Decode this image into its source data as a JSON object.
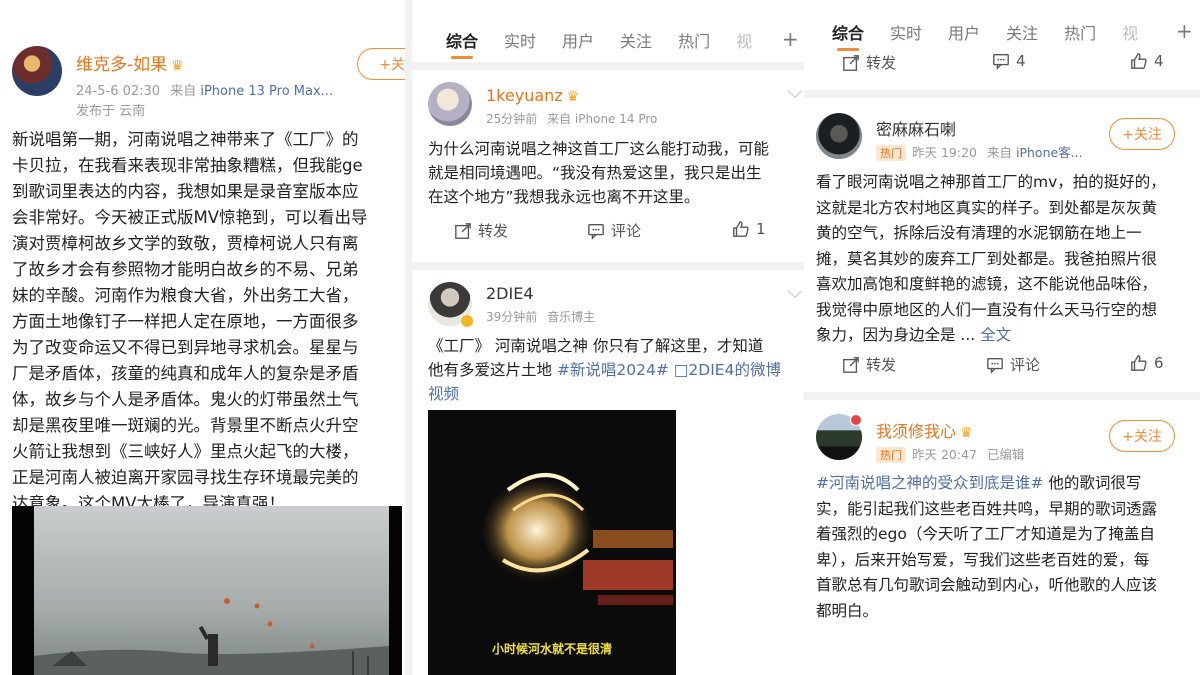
{
  "panel1": {
    "post": {
      "user": "维克多-如果",
      "time": "24-5-6 02:30",
      "source_prefix": "来自",
      "device": "iPhone 13 Pro Max...",
      "location": "发布于 云南",
      "follow": "+关",
      "lines": [
        "新说唱第一期，河南说唱之神带来了《工厂》的",
        "卡贝拉，在我看来表现非常抽象糟糕，但我能ge",
        "到歌词里表达的内容，我想如果是录音室版本应",
        "会非常好。今天被正式版MV惊艳到，可以看出导",
        "演对贾樟柯故乡文学的致敬，贾樟柯说人只有离",
        "了故乡才会有参照物才能明白故乡的不易、兄弟",
        "妹的辛酸。河南作为粮食大省，外出务工大省，",
        "方面土地像钉子一样把人定在原地，一方面很多",
        "为了改变命运又不得已到异地寻求机会。星星与",
        "厂是矛盾体，孩童的纯真和成年人的复杂是矛盾",
        "体，故乡与个人是矛盾体。鬼火的灯带虽然土气",
        "却是黑夜里唯一斑斓的光。背景里不断点火升空",
        "火箭让我想到《三峡好人》里点火起飞的大楼，",
        "正是河南人被迫离开家园寻找生存环境最完美的",
        "达意象。这个MV太棒了，导演真强！"
      ]
    }
  },
  "panel2": {
    "tabs": [
      "综合",
      "实时",
      "用户",
      "关注",
      "热门",
      "视"
    ],
    "post1": {
      "user": "1keyuanz",
      "time": "25分钟前",
      "source": "来自 iPhone 14 Pro",
      "lines": [
        "为什么河南说唱之神这首工厂这么能打动我，可能",
        "就是相同境遇吧。“我没有热爱这里，我只是出生",
        "在这个地方”我想我永远也离不开这里。"
      ],
      "repost": "转发",
      "comment": "评论",
      "like_count": "1"
    },
    "post2": {
      "user": "2DIE4",
      "time": "39分钟前",
      "role": "音乐博主",
      "line1": "《工厂》 河南说唱之神  你只有了解这里，才知道",
      "line2_text": "他有多爱这片土地 ",
      "line2_tag": "#新说唱2024# □2DIE4的微博",
      "line3": "视频",
      "subtitle": "小时候河水就不是很清"
    }
  },
  "panel3": {
    "tabs": [
      "综合",
      "实时",
      "用户",
      "关注",
      "热门",
      "视"
    ],
    "top_actions": {
      "repost": "转发",
      "comment_count": "4",
      "like_count": "4"
    },
    "post1": {
      "user": "密麻麻石喇",
      "hot": "热门",
      "time": "昨天 19:20",
      "source_prefix": "来自",
      "device": "iPhone客...",
      "follow": "+关注",
      "lines": [
        "看了眼河南说唱之神那首工厂的mv，拍的挺好的，",
        "这就是北方农村地区真实的样子。到处都是灰灰黄",
        "黄的空气，拆除后没有清理的水泥钢筋在地上一",
        "摊，莫名其妙的废弃工厂到处都是。我爸拍照片很",
        "喜欢加高饱和度鲜艳的滤镜，这不能说他品味俗，",
        "我觉得中原地区的人们一直没有什么天马行空的想"
      ],
      "last_line": "象力，因为身边全是 ... ",
      "more": "全文",
      "repost": "转发",
      "comment": "评论",
      "like_count": "6"
    },
    "post2": {
      "user": "我须修我心",
      "hot": "热门",
      "time": "昨天 20:47",
      "edited": "已编辑",
      "follow": "+关注",
      "tag": "#河南说唱之神的受众到底是谁#",
      "first_rest": " 他的歌词很写",
      "lines": [
        "实，能引起我们这些老百姓共鸣，早期的歌词透露",
        "着强烈的ego（今天听了工厂才知道是为了掩盖自",
        "卑），后来开始写爱，写我们这些老百姓的爱，每",
        "首歌总有几句歌词会触动到内心，听他歌的人应该",
        "都明白。"
      ]
    }
  }
}
